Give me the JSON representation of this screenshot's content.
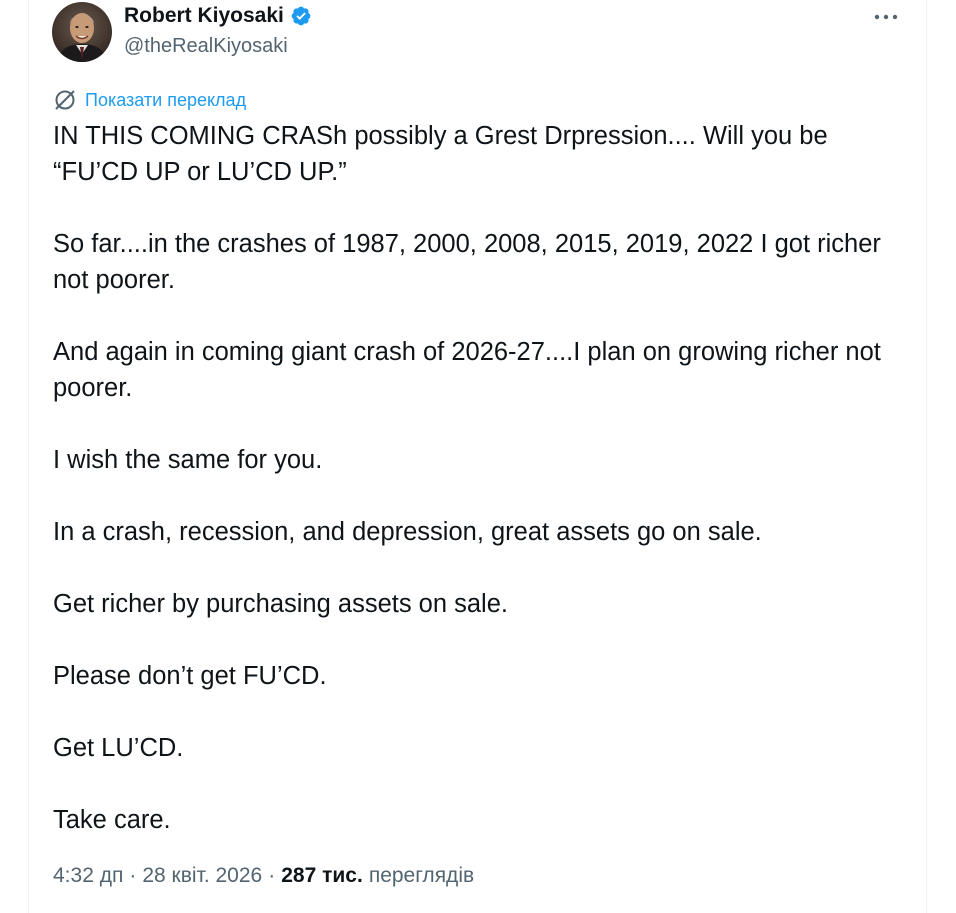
{
  "author": {
    "display_name": "Robert Kiyosaki",
    "handle": "@theRealKiyosaki",
    "verified": true,
    "avatar_icon": "profile-photo"
  },
  "actions": {
    "more_icon": "more-horizontal-icon"
  },
  "translate": {
    "label": "Показати переклад",
    "icon": "globe-icon"
  },
  "tweet": {
    "paragraphs": [
      "IN THIS COMING CRASh possibly a Grest Drpression.... Will you be “FU’CD UP or LU’CD UP.”",
      "So far....in the crashes of 1987, 2000, 2008, 2015, 2019, 2022 I got richer not poorer.",
      "And again in coming giant crash of 2026-27....I plan on growing richer not poorer.",
      "I wish the same for you.",
      "In a crash, recession, and depression, great assets go on sale.",
      "Get richer by purchasing assets on sale.",
      "Please don’t get FU’CD.",
      "Get LU’CD.",
      "Take care."
    ]
  },
  "meta": {
    "time": "4:32 дп",
    "separator": "·",
    "date": "28 квіт. 2026",
    "views_count": "287 тис.",
    "views_label": "переглядів"
  },
  "colors": {
    "accent": "#1d9bf0",
    "text_primary": "#0f1419",
    "text_secondary": "#536471",
    "divider": "#eff3f4"
  }
}
